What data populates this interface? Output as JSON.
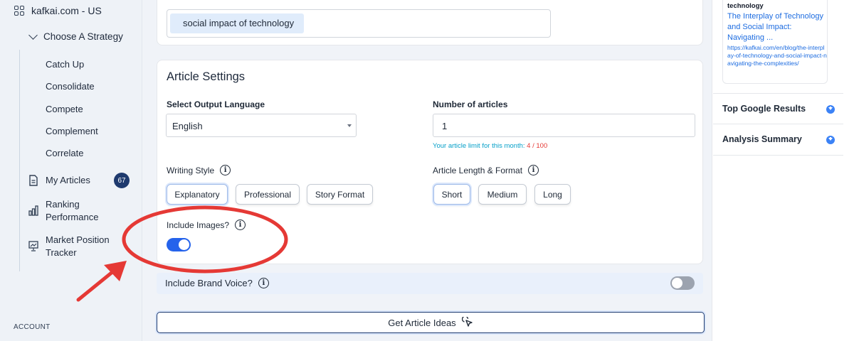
{
  "sidebar": {
    "brand": "kafkai.com - US",
    "strategy_label": "Choose A Strategy",
    "strategies": [
      "Catch Up",
      "Consolidate",
      "Compete",
      "Complement",
      "Correlate"
    ],
    "my_articles": "My Articles",
    "my_articles_count": "67",
    "ranking_line1": "Ranking",
    "ranking_line2": "Performance",
    "market_line1": "Market Position",
    "market_line2": "Tracker",
    "account": "ACCOUNT"
  },
  "topic": {
    "chip": "social impact of technology"
  },
  "settings": {
    "title": "Article Settings",
    "language_label": "Select Output Language",
    "language_value": "English",
    "count_label": "Number of articles",
    "count_value": "1",
    "limit_prefix": "Your article limit for this month:",
    "limit_value": "4 / 100",
    "style_label": "Writing Style",
    "styles": [
      "Explanatory",
      "Professional",
      "Story Format"
    ],
    "length_label": "Article Length & Format",
    "lengths": [
      "Short",
      "Medium",
      "Long"
    ],
    "images_label": "Include Images?",
    "brand_voice_label": "Include Brand Voice?",
    "get_ideas": "Get Article Ideas"
  },
  "right_panel": {
    "kicker": "technology",
    "title": "The Interplay of Technology and Social Impact: Navigating ...",
    "url": "https://kafkai.com/en/blog/the-interplay-of-technology-and-social-impact-navigating-the-complexities/",
    "sections": [
      "Top Google Results",
      "Analysis Summary"
    ]
  },
  "colors": {
    "primary": "#2563eb",
    "navy": "#1e3a6e",
    "link": "#1d6ce0",
    "annotation": "#e53935"
  }
}
